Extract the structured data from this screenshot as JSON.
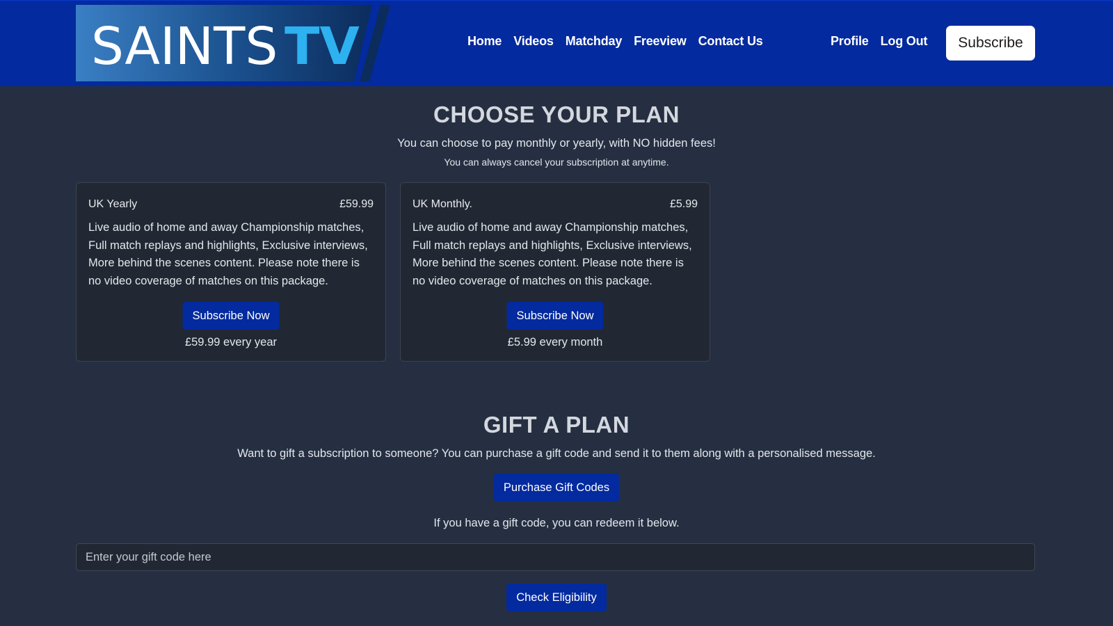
{
  "brand": {
    "name_white": "SAINTS",
    "name_accent": "TV",
    "colors": {
      "nav_bg": "#032a9e",
      "page_bg": "#252f41",
      "card_bg": "#212833",
      "accent": "#2db1f0"
    }
  },
  "nav": {
    "links": [
      "Home",
      "Videos",
      "Matchday",
      "Freeview",
      "Contact Us"
    ],
    "right_links": [
      "Profile",
      "Log Out"
    ],
    "subscribe_label": "Subscribe"
  },
  "plans_section": {
    "title": "CHOOSE YOUR PLAN",
    "subtitle": "You can choose to pay monthly or yearly, with NO hidden fees!",
    "note": "You can always cancel your subscription at anytime.",
    "plans": [
      {
        "name": "UK Yearly",
        "price": "£59.99",
        "description": "Live audio of home and away Championship matches, Full match replays and highlights, Exclusive interviews, More behind the scenes content. Please note there is no video coverage of matches on this package.",
        "button_label": "Subscribe Now",
        "billing": "£59.99 every year"
      },
      {
        "name": "UK Monthly.",
        "price": "£5.99",
        "description": "Live audio of home and away Championship matches, Full match replays and highlights, Exclusive interviews, More behind the scenes content. Please note there is no video coverage of matches on this package.",
        "button_label": "Subscribe Now",
        "billing": "£5.99 every month"
      }
    ]
  },
  "gift_section": {
    "title": "GIFT A PLAN",
    "description": "Want to gift a subscription to someone? You can purchase a gift code and send it to them along with a personalised message.",
    "purchase_button": "Purchase Gift Codes",
    "redeem_text": "If you have a gift code, you can redeem it below.",
    "input_placeholder": "Enter your gift code here",
    "input_value": "",
    "check_button": "Check Eligibility"
  }
}
